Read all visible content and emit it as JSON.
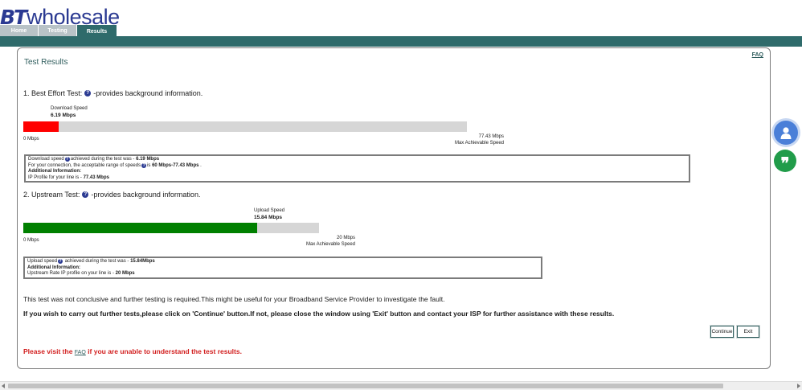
{
  "brand": {
    "logo_bt": "BT",
    "logo_wholesale": "wholesale"
  },
  "tabs": [
    {
      "label": "Home",
      "active": false
    },
    {
      "label": "Testing",
      "active": false
    },
    {
      "label": "Results",
      "active": true
    }
  ],
  "panel": {
    "title": "Test Results",
    "faq_label": "FAQ"
  },
  "best_effort": {
    "heading_prefix": "1. Best Effort Test:",
    "heading_suffix": "-provides background information.",
    "gauge_label": "Download Speed",
    "gauge_value": "6.19 Mbps",
    "measured_mbps": 6.19,
    "max_mbps": 77.43,
    "fill_color": "#ff0000",
    "scale_min": "0 Mbps",
    "scale_max": "77.43 Mbps",
    "scale_max_caption": "Max Achievable Speed",
    "info": {
      "line1_prefix": "Download speed",
      "line1_mid": "achieved during the test was - ",
      "line1_value": "6.19 Mbps",
      "line2_prefix": "For your connection, the acceptable range of speeds",
      "line2_mid": "is ",
      "line2_value": "60 Mbps-77.43 Mbps",
      "line2_suffix": " .",
      "additional_label": "Additional Information:",
      "line4_prefix": "IP Profile for your line is - ",
      "line4_value": "77.43 Mbps"
    }
  },
  "upstream": {
    "heading_prefix": "2. Upstream Test:",
    "heading_suffix": "-provides background information.",
    "gauge_label": "Upload Speed",
    "gauge_value": "15.84 Mbps",
    "measured_mbps": 15.84,
    "max_mbps": 20,
    "fill_color": "#008000",
    "scale_min": "0 Mbps",
    "scale_max": "20 Mbps",
    "scale_max_caption": "Max Achievable Speed",
    "info": {
      "line1_prefix": "Upload speed",
      "line1_mid": " achieved during the test was - ",
      "line1_value": "15.84Mbps",
      "additional_label": "Additional Information:",
      "line3_prefix": "Upstream Rate IP profile on your line is - ",
      "line3_value": "20 Mbps"
    }
  },
  "messages": {
    "inconclusive": "This test was not conclusive and further testing is required.This might be useful for your Broadband Service Provider to investigate the fault.",
    "instruction": "If you wish to carry out further tests,please click on 'Continue' button.If not, please close the window using 'Exit' button and contact your ISP for further assistance with these results."
  },
  "buttons": {
    "continue": "Continue",
    "exit": "Exit"
  },
  "visit": {
    "prefix": "Please visit the ",
    "link": "FAQ",
    "suffix": " if you are unable to understand the test results."
  },
  "colors": {
    "brand_blue": "#2b3a92",
    "teal": "#2f6b6b",
    "alert_red": "#d21f1f"
  },
  "icons": {
    "info": "question-circle-icon",
    "side_user": "user-icon",
    "side_quote": "quote-icon"
  }
}
